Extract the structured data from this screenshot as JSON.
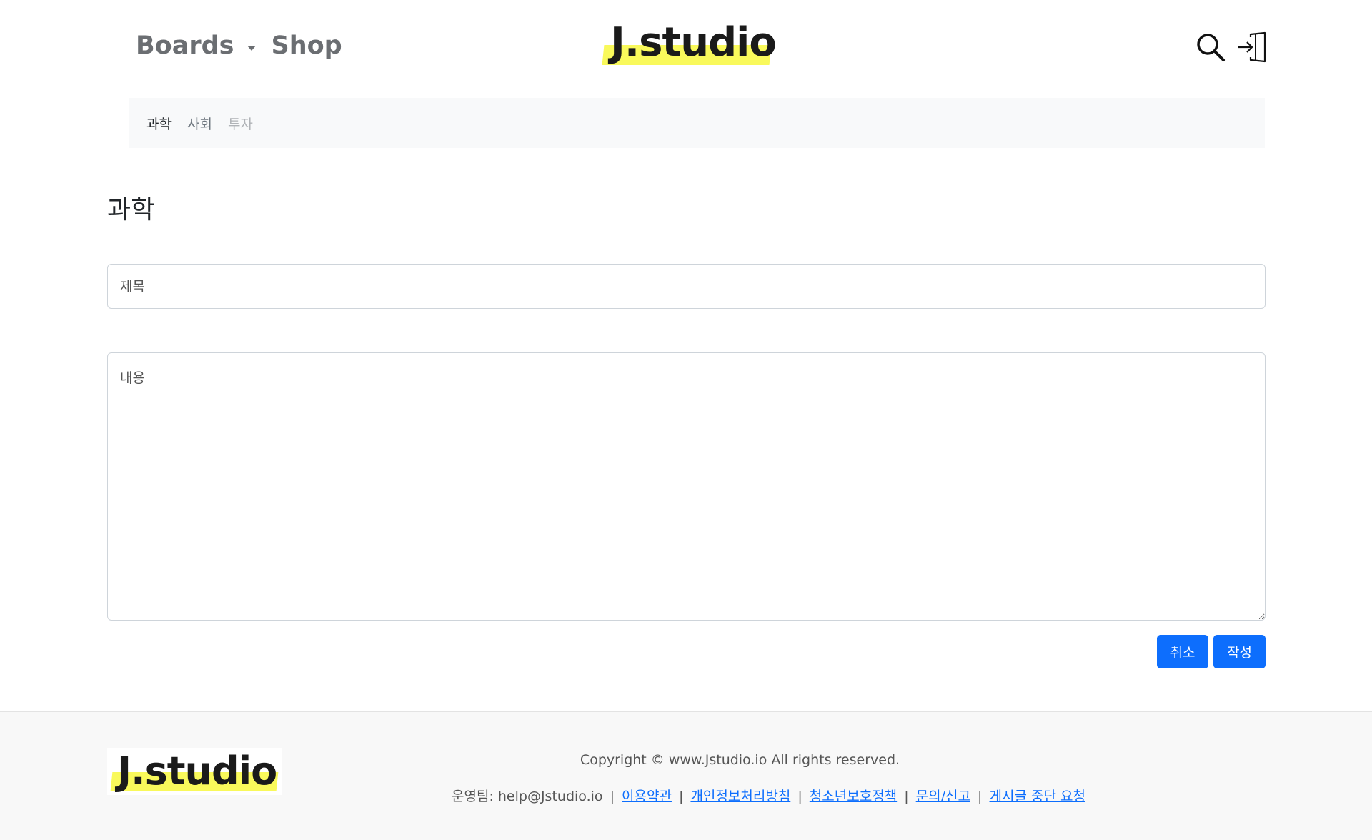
{
  "header": {
    "nav": {
      "boards": "Boards",
      "shop": "Shop"
    },
    "brand": "J.studio",
    "icons": {
      "search": "search-icon",
      "login": "login-icon"
    }
  },
  "subnav": {
    "items": [
      {
        "label": "과학",
        "state": "active"
      },
      {
        "label": "사회",
        "state": "normal"
      },
      {
        "label": "투자",
        "state": "muted"
      }
    ]
  },
  "main": {
    "title": "과학",
    "title_placeholder": "제목",
    "content_placeholder": "내용",
    "cancel_label": "취소",
    "submit_label": "작성",
    "accent": "#0d6efd"
  },
  "footer": {
    "brand": "J.studio",
    "copyright": "Copyright © www.Jstudio.io All rights reserved.",
    "contact": "운영팀: help@Jstudio.io",
    "links": [
      "이용약관",
      "개인정보처리방침",
      "청소년보호정책",
      "문의/신고",
      "게시글 중단 요청"
    ]
  }
}
